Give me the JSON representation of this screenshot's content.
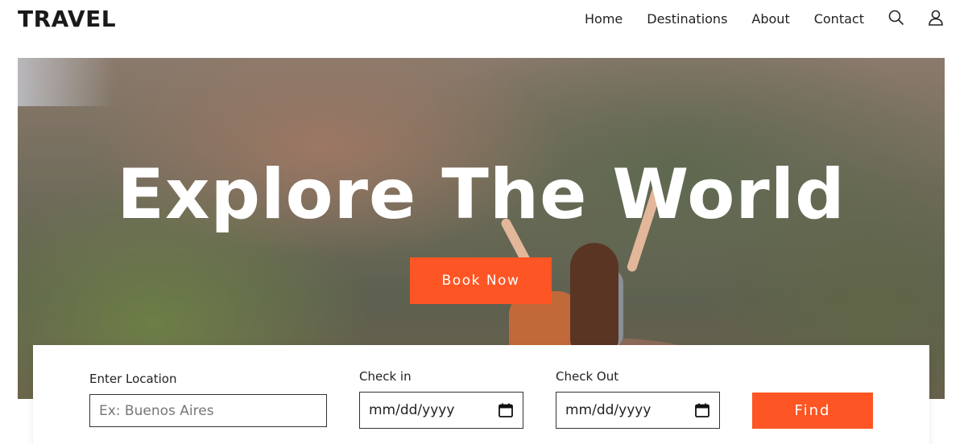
{
  "header": {
    "logo": "TRAVEL",
    "nav": [
      "Home",
      "Destinations",
      "About",
      "Contact"
    ],
    "icons": [
      "search-icon",
      "user-icon"
    ]
  },
  "hero": {
    "title": "Explore The World",
    "cta_label": "Book Now"
  },
  "search": {
    "location_label": "Enter Location",
    "location_placeholder": "Ex: Buenos Aires",
    "checkin_label": "Check in",
    "checkin_value": "mm/dd/yyyy",
    "checkout_label": "Check Out",
    "checkout_value": "mm/dd/yyyy",
    "find_label": "Find"
  },
  "colors": {
    "accent": "#fd5523",
    "text": "#222222",
    "background": "#ffffff"
  }
}
